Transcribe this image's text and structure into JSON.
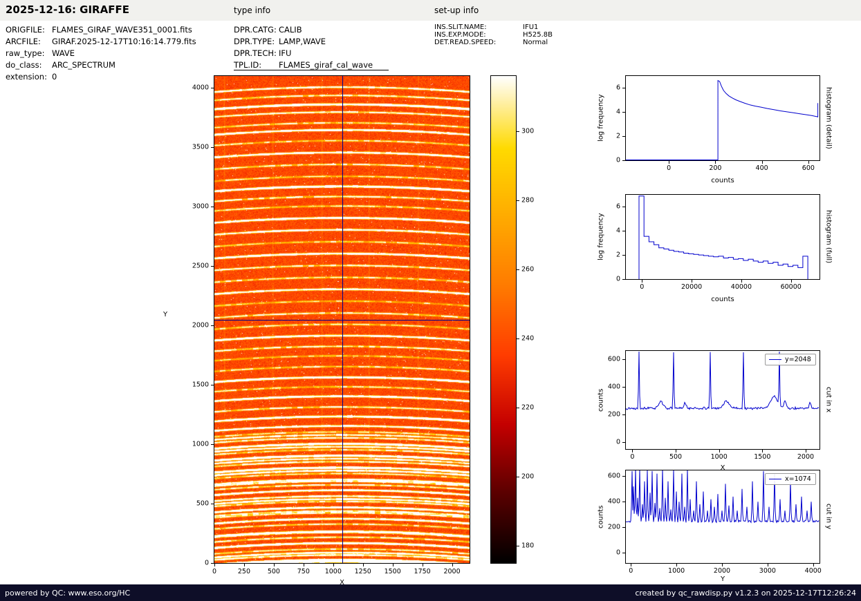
{
  "header": {
    "title": "2025-12-16: GIRAFFE",
    "type_info_label": "type info",
    "setup_info_label": "set-up info"
  },
  "metadata": {
    "left": [
      {
        "key": "ORIGFILE:",
        "value": "FLAMES_GIRAF_WAVE351_0001.fits"
      },
      {
        "key": "ARCFILE:",
        "value": "GIRAF.2025-12-17T10:16:14.779.fits"
      },
      {
        "key": "raw_type:",
        "value": "WAVE"
      },
      {
        "key": "do_class:",
        "value": "ARC_SPECTRUM"
      },
      {
        "key": "extension:",
        "value": "0"
      }
    ],
    "type_info": [
      {
        "key": "DPR.CATG:",
        "value": "CALIB"
      },
      {
        "key": "DPR.TYPE:",
        "value": "LAMP,WAVE"
      },
      {
        "key": "DPR.TECH:",
        "value": "IFU"
      },
      {
        "key": "TPL.ID:",
        "value": "FLAMES_giraf_cal_wave"
      }
    ],
    "setup_info": [
      {
        "key": "INS.SLIT.NAME:",
        "value": "IFU1"
      },
      {
        "key": "INS.EXP.MODE:",
        "value": "H525.8B"
      },
      {
        "key": "DET.READ.SPEED:",
        "value": "Normal"
      }
    ]
  },
  "footer": {
    "left": "powered by QC: www.eso.org/HC",
    "right": "created by qc_rawdisp.py v1.2.3 on 2025-12-17T12:26:24"
  },
  "colors": {
    "line": "#0000cd",
    "crosshair": "#00008b",
    "header_bg": "#f1f1ee",
    "footer_bg": "#0e0e28",
    "footer_text": "#ffffff"
  },
  "chart_data": [
    {
      "type": "heatmap",
      "name": "GIRAFFE raw arc-lamp IFU frame",
      "xlabel": "X",
      "ylabel": "Y",
      "xlim": [
        0,
        2148
      ],
      "ylim": [
        0,
        4096
      ],
      "xticks": [
        0,
        250,
        500,
        750,
        1000,
        1250,
        1500,
        1750,
        2000
      ],
      "yticks": [
        0,
        500,
        1000,
        1500,
        2000,
        2500,
        3000,
        3500,
        4000
      ],
      "background_counts": 239,
      "crosshair": {
        "x": 1074,
        "y": 2048
      },
      "simcal_columns_x": [
        80,
        490,
        900,
        1300,
        1710
      ],
      "arc_lines": [
        [
          15,
          260
        ],
        [
          30,
          320
        ],
        [
          70,
          150
        ],
        [
          90,
          200
        ],
        [
          120,
          90
        ],
        [
          170,
          360
        ],
        [
          220,
          100
        ],
        [
          260,
          120
        ],
        [
          270,
          170
        ],
        [
          330,
          80
        ],
        [
          375,
          240
        ],
        [
          425,
          110
        ],
        [
          440,
          140
        ],
        [
          470,
          310
        ],
        [
          520,
          90
        ],
        [
          540,
          200
        ],
        [
          565,
          160
        ],
        [
          615,
          280
        ],
        [
          660,
          110
        ],
        [
          690,
          130
        ],
        [
          705,
          190
        ],
        [
          755,
          80
        ],
        [
          780,
          240
        ],
        [
          805,
          330
        ],
        [
          855,
          130
        ],
        [
          880,
          150
        ],
        [
          905,
          420
        ],
        [
          955,
          100
        ],
        [
          980,
          180
        ],
        [
          1005,
          390
        ],
        [
          1055,
          120
        ],
        [
          1080,
          160
        ],
        [
          1105,
          80
        ],
        [
          1155,
          220
        ],
        [
          1235,
          350
        ],
        [
          1315,
          100
        ],
        [
          1405,
          290
        ],
        [
          1485,
          80
        ],
        [
          1565,
          330
        ],
        [
          1655,
          90
        ],
        [
          1745,
          70
        ],
        [
          1825,
          110
        ],
        [
          1915,
          270
        ],
        [
          2010,
          80
        ],
        [
          2105,
          100
        ],
        [
          2205,
          70
        ],
        [
          2305,
          230
        ],
        [
          2405,
          90
        ],
        [
          2505,
          110
        ],
        [
          2605,
          290
        ],
        [
          2705,
          80
        ],
        [
          2805,
          210
        ],
        [
          2905,
          350
        ],
        [
          3005,
          90
        ],
        [
          3085,
          110
        ],
        [
          3170,
          390
        ],
        [
          3255,
          80
        ],
        [
          3355,
          100
        ],
        [
          3455,
          250
        ],
        [
          3555,
          80
        ],
        [
          3645,
          290
        ],
        [
          3705,
          90
        ],
        [
          3795,
          120
        ],
        [
          3860,
          430
        ],
        [
          3935,
          110
        ],
        [
          4005,
          170
        ]
      ],
      "colorbar": {
        "vmin": 175,
        "vmax": 316,
        "ticks": [
          180,
          200,
          220,
          240,
          260,
          280,
          300
        ],
        "stops": [
          [
            175,
            "#000000"
          ],
          [
            195,
            "#5a0000"
          ],
          [
            215,
            "#c40000"
          ],
          [
            235,
            "#ff3c00"
          ],
          [
            255,
            "#ff7a00"
          ],
          [
            275,
            "#ffaa00"
          ],
          [
            295,
            "#ffda00"
          ],
          [
            308,
            "#ffefa0"
          ],
          [
            316,
            "#ffffff"
          ]
        ]
      }
    },
    {
      "type": "line",
      "right_label": "histogram (detail)",
      "xlabel": "counts",
      "ylabel": "log frequency",
      "xlim": [
        -185,
        648
      ],
      "ylim": [
        0,
        7
      ],
      "xticks": [
        0,
        200,
        400,
        600
      ],
      "yticks": [
        0,
        2,
        4,
        6
      ],
      "x": [
        -185,
        205,
        211,
        211,
        218,
        226,
        235,
        246,
        258,
        272,
        288,
        306,
        326,
        348,
        372,
        398,
        424,
        452,
        480,
        508,
        536,
        564,
        592,
        614,
        628,
        638,
        641,
        641
      ],
      "y": [
        0.03,
        0.03,
        0.03,
        6.62,
        6.55,
        6.15,
        5.8,
        5.55,
        5.35,
        5.18,
        5.02,
        4.88,
        4.74,
        4.6,
        4.5,
        4.4,
        4.3,
        4.2,
        4.1,
        4.02,
        3.94,
        3.86,
        3.78,
        3.72,
        3.66,
        3.62,
        3.6,
        4.75
      ]
    },
    {
      "type": "step",
      "right_label": "histogram (full)",
      "xlabel": "counts",
      "ylabel": "log frequency",
      "xlim": [
        -6500,
        71500
      ],
      "ylim": [
        0,
        7
      ],
      "xticks": [
        0,
        20000,
        40000,
        60000
      ],
      "yticks": [
        0,
        2,
        4,
        6
      ],
      "step": {
        "x0": -1200,
        "dx": 2000,
        "values": [
          6.9,
          3.55,
          3.1,
          2.85,
          2.6,
          2.5,
          2.4,
          2.3,
          2.25,
          2.15,
          2.1,
          2.05,
          2.0,
          1.95,
          1.9,
          1.85,
          1.9,
          1.75,
          1.8,
          1.65,
          1.7,
          1.55,
          1.65,
          1.5,
          1.4,
          1.5,
          1.3,
          1.4,
          1.15,
          1.25,
          1.05,
          1.15,
          0.95,
          1.9
        ]
      }
    },
    {
      "type": "cut",
      "right_label": "cut in x",
      "xlabel": "X",
      "ylabel": "counts",
      "legend": "y=2048",
      "xlim": [
        -75,
        2160
      ],
      "ylim": [
        -50,
        660
      ],
      "xticks": [
        0,
        500,
        1000,
        1500,
        2000
      ],
      "yticks": [
        0,
        200,
        400,
        600
      ],
      "baseline": 245,
      "noise": 5,
      "spikes": [
        [
          75,
          655
        ],
        [
          480,
          650
        ],
        [
          900,
          652
        ],
        [
          1290,
          650
        ],
        [
          1700,
          655
        ]
      ],
      "bumps": [
        [
          330,
          295,
          35
        ],
        [
          610,
          282,
          18
        ],
        [
          1090,
          298,
          45
        ],
        [
          1640,
          332,
          55
        ],
        [
          1770,
          300,
          20
        ],
        [
          2060,
          283,
          15
        ]
      ]
    },
    {
      "type": "cut",
      "right_label": "cut in y",
      "xlabel": "Y",
      "ylabel": "counts",
      "legend": "x=1074",
      "xlim": [
        -110,
        4140
      ],
      "ylim": [
        -80,
        645
      ],
      "xticks": [
        0,
        1000,
        2000,
        3000,
        4000
      ],
      "yticks": [
        0,
        200,
        400,
        600
      ],
      "baseline": 245,
      "noise": 5,
      "spikes": [
        [
          30,
          640
        ],
        [
          60,
          520
        ],
        [
          100,
          660
        ],
        [
          150,
          430
        ],
        [
          200,
          655
        ],
        [
          250,
          380
        ],
        [
          300,
          560
        ],
        [
          360,
          650
        ],
        [
          420,
          470
        ],
        [
          470,
          640
        ],
        [
          530,
          390
        ],
        [
          580,
          620
        ],
        [
          640,
          350
        ],
        [
          700,
          655
        ],
        [
          760,
          430
        ],
        [
          820,
          560
        ],
        [
          880,
          340
        ],
        [
          940,
          650
        ],
        [
          1000,
          480
        ],
        [
          1060,
          400
        ],
        [
          1120,
          620
        ],
        [
          1180,
          360
        ],
        [
          1240,
          655
        ],
        [
          1310,
          420
        ],
        [
          1380,
          330
        ],
        [
          1450,
          560
        ],
        [
          1520,
          380
        ],
        [
          1600,
          480
        ],
        [
          1680,
          330
        ],
        [
          1760,
          420
        ],
        [
          1840,
          360
        ],
        [
          1920,
          460
        ],
        [
          2000,
          330
        ],
        [
          2080,
          540
        ],
        [
          2160,
          370
        ],
        [
          2250,
          440
        ],
        [
          2350,
          330
        ],
        [
          2450,
          500
        ],
        [
          2560,
          360
        ],
        [
          2680,
          560
        ],
        [
          2800,
          400
        ],
        [
          2920,
          640
        ],
        [
          3040,
          360
        ],
        [
          3160,
          620
        ],
        [
          3280,
          420
        ],
        [
          3400,
          330
        ],
        [
          3520,
          560
        ],
        [
          3640,
          380
        ],
        [
          3760,
          440
        ],
        [
          3880,
          330
        ],
        [
          3980,
          400
        ]
      ],
      "bumps": []
    }
  ]
}
